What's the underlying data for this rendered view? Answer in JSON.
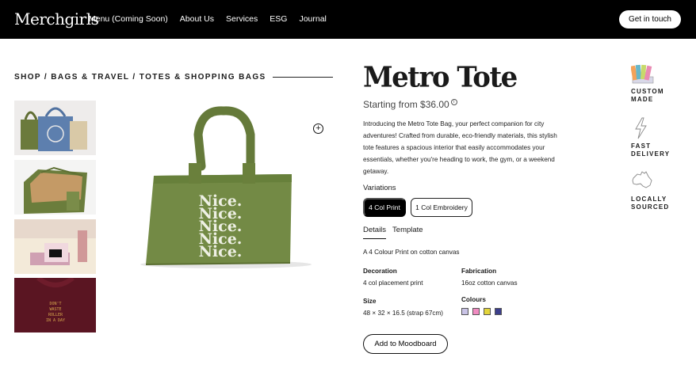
{
  "header": {
    "logo": "Merchgirls",
    "nav": [
      "Menu (Coming Soon)",
      "About Us",
      "Services",
      "ESG",
      "Journal"
    ],
    "cta": "Get in touch"
  },
  "breadcrumb": "SHOP / BAGS & TRAVEL / TOTES & SHOPPING BAGS",
  "product": {
    "title": "Metro Tote",
    "price": "Starting from $36.00",
    "description": "Introducing the Metro Tote Bag, your perfect companion for city adventures! Crafted from durable, eco-friendly materials, this stylish tote features a spacious interior that easily accommodates your essentials, whether you're heading to work, the gym, or a weekend getaway.",
    "variations_label": "Variations",
    "variations": [
      "4 Col Print",
      "1 Col Embroidery"
    ],
    "tabs": [
      "Details",
      "Template"
    ],
    "fabric_desc": "A 4 Colour Print on cotton canvas",
    "decoration": {
      "label": "Decoration",
      "value": "4 col placement print"
    },
    "fabrication": {
      "label": "Fabrication",
      "value": "16oz cotton canvas"
    },
    "size": {
      "label": "Size",
      "value": "48 × 32 × 16.5 (strap 67cm)"
    },
    "colours": {
      "label": "Colours",
      "swatches": [
        "#c9c3e6",
        "#f08bc1",
        "#e3d53a",
        "#3c3f8c"
      ]
    },
    "moodboard_label": "Add to Moodboard",
    "bag_print": "Nice."
  },
  "features": [
    {
      "icon": "color-palette-icon",
      "label": "CUSTOM MADE"
    },
    {
      "icon": "lightning-icon",
      "label": "FAST DELIVERY"
    },
    {
      "icon": "australia-map-icon",
      "label": "LOCALLY SOURCED"
    }
  ],
  "thumb4_text": "DON'T WASTE ROLLER IN A DAY"
}
